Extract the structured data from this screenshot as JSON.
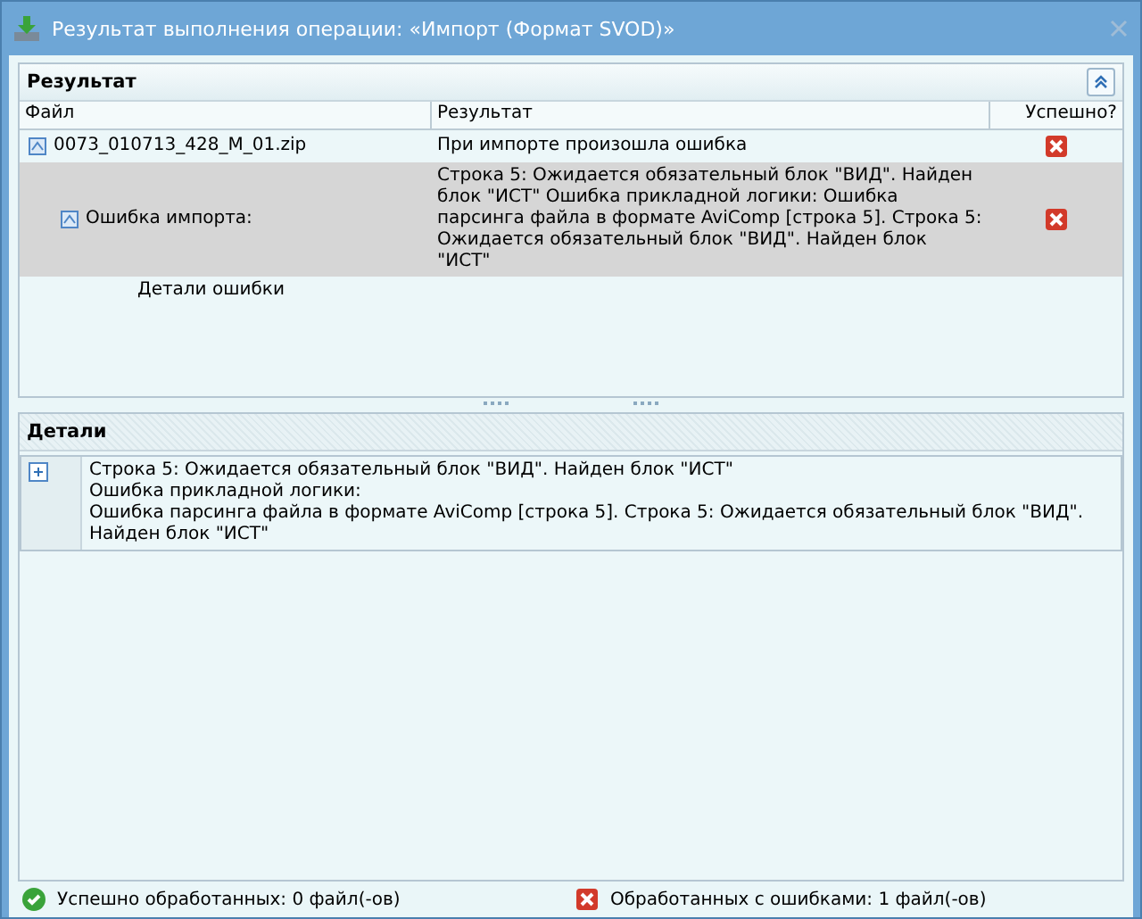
{
  "window": {
    "title": "Результат выполнения операции: «Импорт (Формат SVOD)»"
  },
  "result_panel": {
    "title": "Результат",
    "collapsed": false,
    "columns": [
      "Файл",
      "Результат",
      "Успешно?"
    ],
    "rows": [
      {
        "file": "0073_010713_428_M_01.zip",
        "result": "При импорте произошла ошибка",
        "success": false,
        "selected": false,
        "children": [
          {
            "file": "Ошибка импорта:",
            "result": "Строка 5: Ожидается обязательный блок \"ВИД\". Найден блок \"ИСТ\" Ошибка прикладной логики: Ошибка парсинга файла в формате AviComp [строка 5]. Строка 5: Ожидается обязательный блок \"ВИД\". Найден блок \"ИСТ\"",
            "success": false,
            "selected": true,
            "children": [
              {
                "file": "Детали ошибки",
                "selected": false
              }
            ]
          }
        ]
      }
    ]
  },
  "details_panel": {
    "title": "Детали",
    "expanded": false,
    "lines": [
      "Строка 5: Ожидается обязательный блок \"ВИД\". Найден блок \"ИСТ\"",
      "Ошибка прикладной логики:",
      "Ошибка парсинга файла в формате AviComp [строка 5]. Строка 5: Ожидается обязательный блок \"ВИД\". Найден блок \"ИСТ\""
    ]
  },
  "status_bar": [
    {
      "kind": "success",
      "text": "Успешно обработанных: 0 файл(-ов)"
    },
    {
      "kind": "error",
      "text": "Обработанных с ошибками: 1 файл(-ов)"
    }
  ]
}
